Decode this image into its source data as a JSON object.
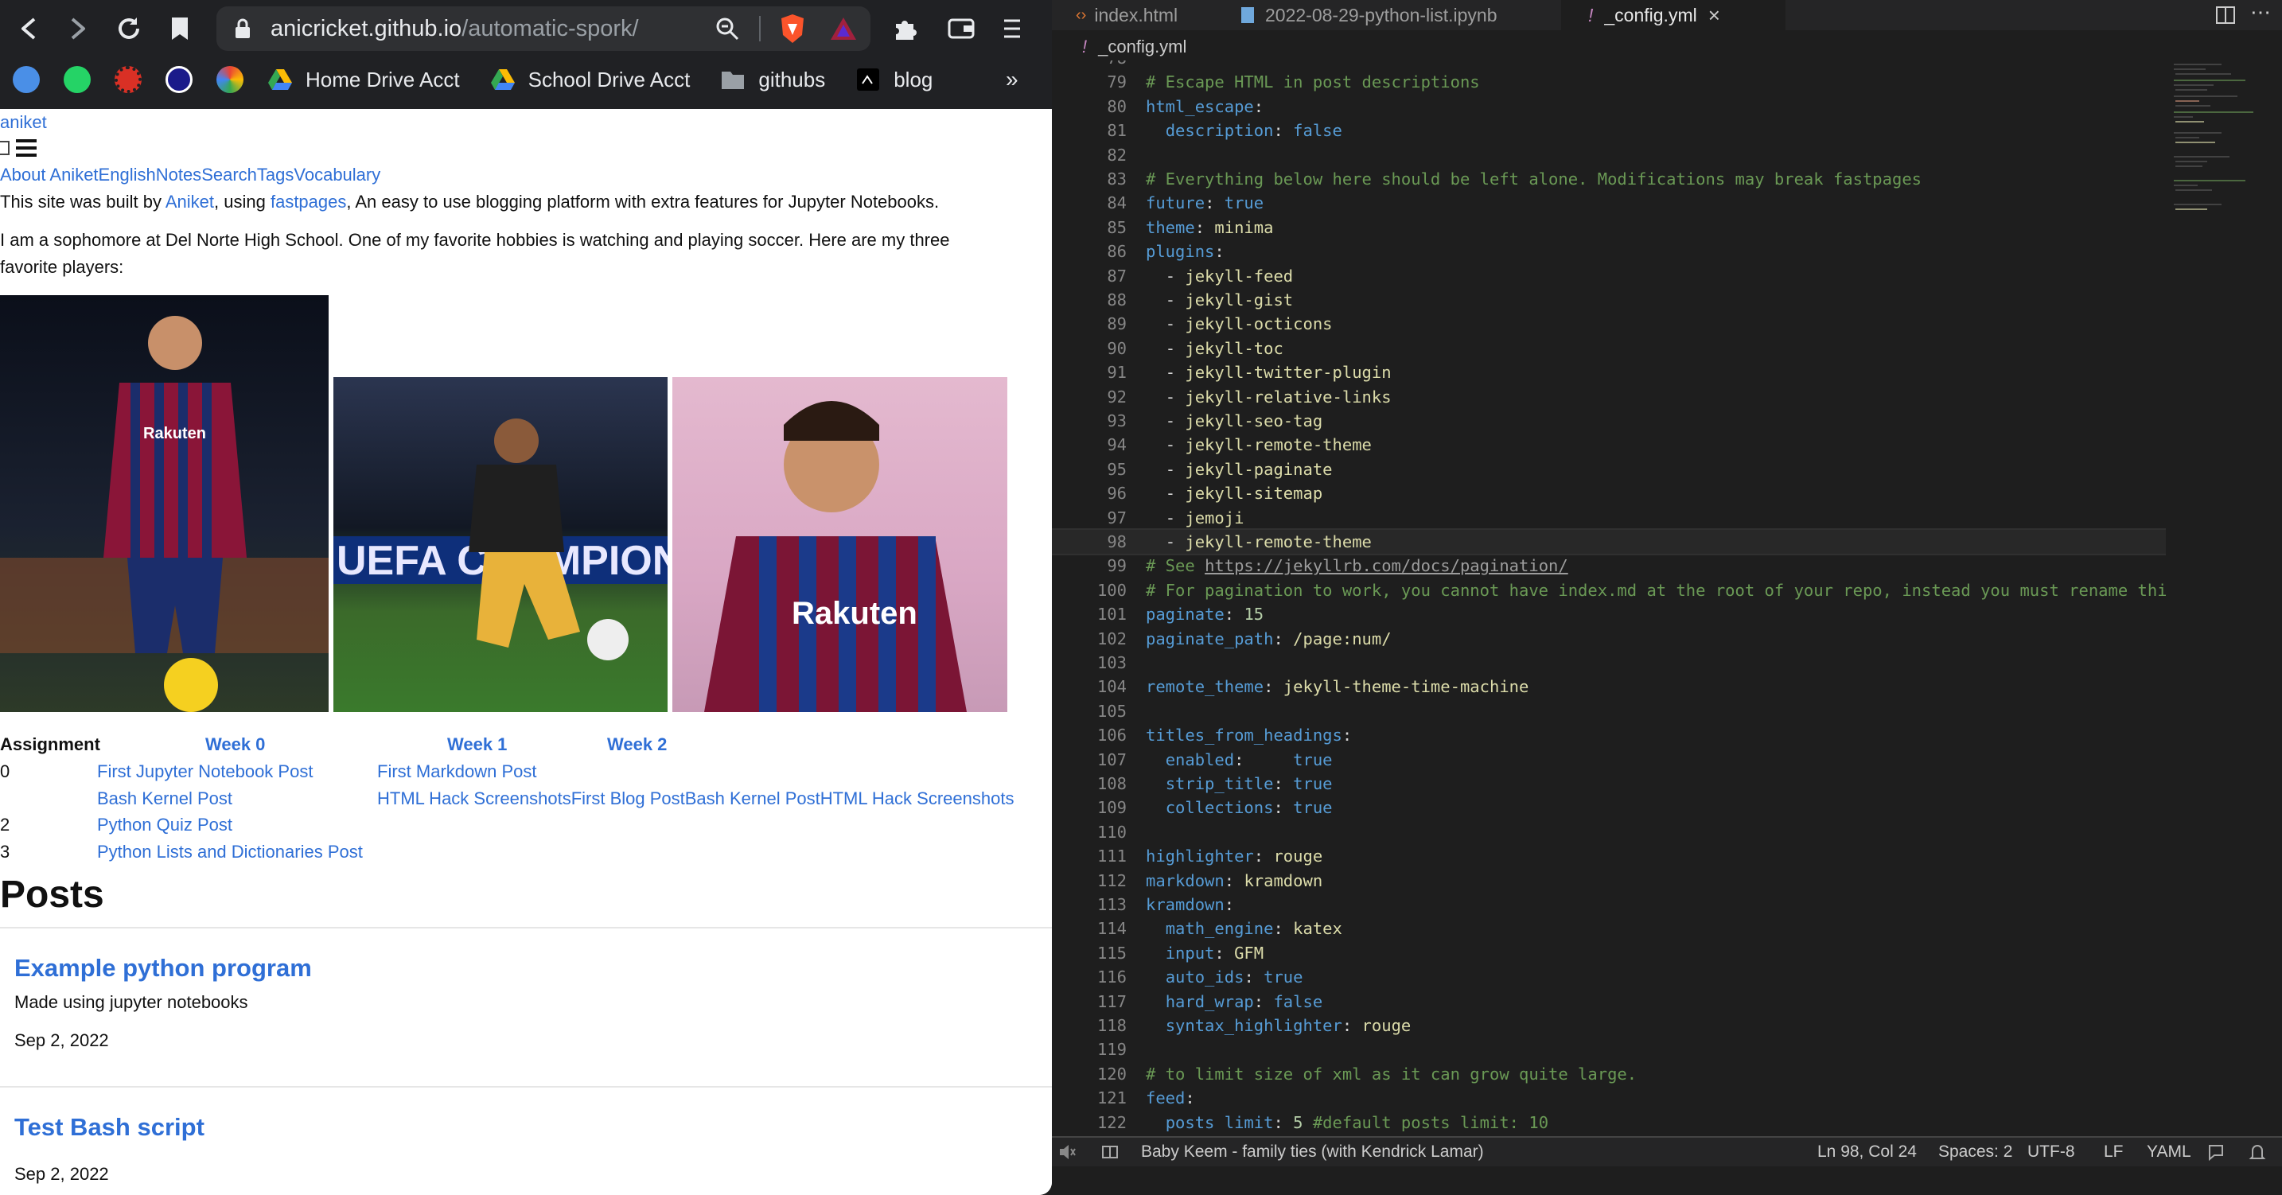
{
  "browser": {
    "url_host": "anicricket.github.io",
    "url_path": "/automatic-spork/",
    "bookmarks": [
      {
        "label": "Home Drive Acct",
        "icon": "google-drive-icon"
      },
      {
        "label": "School Drive Acct",
        "icon": "google-drive-icon"
      },
      {
        "label": "githubs",
        "icon": "folder-icon"
      },
      {
        "label": "blog",
        "icon": "fastpages-icon"
      }
    ],
    "bookmark_more": "»"
  },
  "site": {
    "brand": "aniket",
    "nav": [
      "About Aniket",
      "English",
      "Notes",
      "Search",
      "Tags",
      "Vocabulary"
    ],
    "built_prefix": "This site was built by ",
    "built_author": "Aniket",
    "built_mid": ", using ",
    "built_link": "fastpages",
    "built_suffix": ", An easy to use blogging platform with extra features for Jupyter Notebooks.",
    "intro_1": "I am a sophomore at Del Norte High School. One of my favorite hobbies is watching and playing soccer. Here are my three",
    "intro_2": "favorite players:",
    "images": [
      {
        "kit": "Rakuten",
        "shirt": "#8a1538"
      },
      {
        "kit": "UEFA CHAMPIONS",
        "shirt": "#1f1f1f"
      },
      {
        "kit": "Rakuten",
        "shirt": "#7b1535"
      }
    ]
  },
  "table": {
    "headers": [
      "Assignment",
      "Week 0",
      "Week 1",
      "Week 2"
    ],
    "rows": [
      {
        "num": "0",
        "col1": "First Jupyter Notebook Post",
        "col2": "First Markdown Post"
      },
      {
        "num": "",
        "col1": "Bash Kernel Post",
        "col2": "HTML Hack ScreenshotsFirst Blog PostBash Kernel PostHTML Hack Screenshots"
      },
      {
        "num": "2",
        "col1": "Python Quiz Post",
        "col2": ""
      },
      {
        "num": "3",
        "col1": "Python Lists and Dictionaries Post",
        "col2": ""
      }
    ]
  },
  "posts": {
    "heading": "Posts",
    "items": [
      {
        "title": "Example python program",
        "desc": "Made using jupyter notebooks",
        "date": "Sep 2, 2022"
      },
      {
        "title": "Test Bash script",
        "desc": "",
        "date": "Sep 2, 2022"
      }
    ]
  },
  "editor": {
    "tabs": [
      {
        "label": "index.html",
        "icon": "<>"
      },
      {
        "label": "2022-08-29-python-list.ipynb",
        "icon": "notebook"
      },
      {
        "label": "_config.yml",
        "icon": "!"
      }
    ],
    "breadcrumb": "_config.yml",
    "lines": [
      {
        "n": "78",
        "t": ""
      },
      {
        "n": "79",
        "t": "# Escape HTML in post descriptions"
      },
      {
        "n": "80",
        "t": "html_escape:"
      },
      {
        "n": "81",
        "t": "  description: false"
      },
      {
        "n": "82",
        "t": ""
      },
      {
        "n": "83",
        "t": "# Everything below here should be left alone. Modifications may break fastpages"
      },
      {
        "n": "84",
        "t": "future: true"
      },
      {
        "n": "85",
        "t": "theme: minima"
      },
      {
        "n": "86",
        "t": "plugins:"
      },
      {
        "n": "87",
        "t": "  - jekyll-feed"
      },
      {
        "n": "88",
        "t": "  - jekyll-gist"
      },
      {
        "n": "89",
        "t": "  - jekyll-octicons"
      },
      {
        "n": "90",
        "t": "  - jekyll-toc"
      },
      {
        "n": "91",
        "t": "  - jekyll-twitter-plugin"
      },
      {
        "n": "92",
        "t": "  - jekyll-relative-links"
      },
      {
        "n": "93",
        "t": "  - jekyll-seo-tag"
      },
      {
        "n": "94",
        "t": "  - jekyll-remote-theme"
      },
      {
        "n": "95",
        "t": "  - jekyll-paginate"
      },
      {
        "n": "96",
        "t": "  - jekyll-sitemap"
      },
      {
        "n": "97",
        "t": "  - jemoji"
      },
      {
        "n": "98",
        "t": "  - jekyll-remote-theme"
      },
      {
        "n": "99",
        "t": "# See https://jekyllrb.com/docs/pagination/"
      },
      {
        "n": "100",
        "t": "# For pagination to work, you cannot have index.md at the root of your repo, instead you must rename this f"
      },
      {
        "n": "101",
        "t": "paginate: 15"
      },
      {
        "n": "102",
        "t": "paginate_path: /page:num/"
      },
      {
        "n": "103",
        "t": ""
      },
      {
        "n": "104",
        "t": "remote_theme: jekyll-theme-time-machine"
      },
      {
        "n": "105",
        "t": ""
      },
      {
        "n": "106",
        "t": "titles_from_headings:"
      },
      {
        "n": "107",
        "t": "  enabled:     true"
      },
      {
        "n": "108",
        "t": "  strip_title: true"
      },
      {
        "n": "109",
        "t": "  collections: true"
      },
      {
        "n": "110",
        "t": ""
      },
      {
        "n": "111",
        "t": "highlighter: rouge"
      },
      {
        "n": "112",
        "t": "markdown: kramdown"
      },
      {
        "n": "113",
        "t": "kramdown:"
      },
      {
        "n": "114",
        "t": "  math_engine: katex"
      },
      {
        "n": "115",
        "t": "  input: GFM"
      },
      {
        "n": "116",
        "t": "  auto_ids: true"
      },
      {
        "n": "117",
        "t": "  hard_wrap: false"
      },
      {
        "n": "118",
        "t": "  syntax_highlighter: rouge"
      },
      {
        "n": "119",
        "t": ""
      },
      {
        "n": "120",
        "t": "# to limit size of xml as it can grow quite large."
      },
      {
        "n": "121",
        "t": "feed:"
      },
      {
        "n": "122",
        "t": "  posts_limit: 5 #default posts_limit: 10"
      }
    ],
    "status": {
      "music": "Baby Keem - family ties (with Kendrick Lamar)",
      "position": "Ln 98, Col 24",
      "spaces": "Spaces: 2",
      "encoding": "UTF-8",
      "eol": "LF",
      "language": "YAML"
    }
  }
}
